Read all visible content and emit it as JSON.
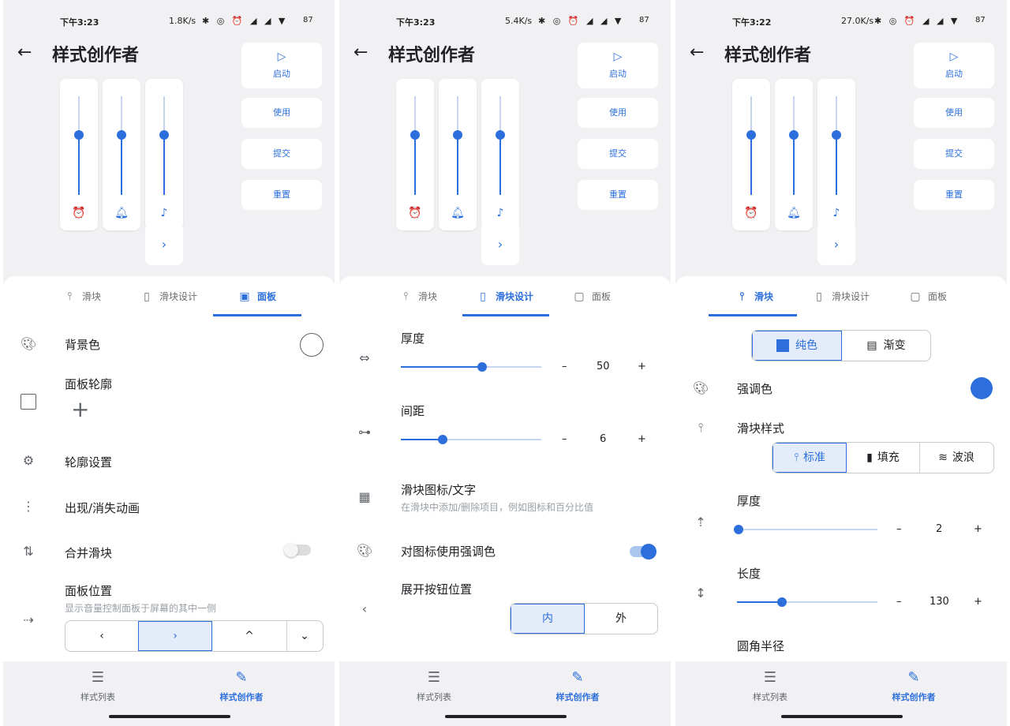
{
  "colors": {
    "accent": "#2c6fdc",
    "accent_light": "#c6d6f2",
    "bg_top": "#f1f1f3"
  },
  "screens": [
    {
      "status": {
        "time": "下午3:23",
        "speed": "1.8K/s",
        "battery": "87"
      },
      "header": {
        "title": "样式创作者",
        "back_icon": "back-arrow-icon"
      },
      "sliders": [
        "alarm-icon",
        "bell-icon",
        "music-note-icon"
      ],
      "controls": {
        "start": "启动",
        "use": "使用",
        "submit": "提交",
        "reset": "重置"
      },
      "expand_label": "›",
      "tabs": [
        {
          "label": "滑块",
          "icon": "slider-icon",
          "active": false
        },
        {
          "label": "滑块设计",
          "icon": "slider-design-icon",
          "active": false
        },
        {
          "label": "面板",
          "icon": "panel-icon",
          "active": true
        }
      ],
      "settings": {
        "background_color": "背景色",
        "panel_outline": "面板轮廓",
        "outline_settings": "轮廓设置",
        "show_hide_animation": "出现/消失动画",
        "merge_sliders": "合并滑块",
        "merge_sliders_enabled": false,
        "panel_position": "面板位置",
        "panel_position_desc": "显示音量控制面板于屏幕的其中一侧",
        "position_options": [
          "‹",
          "›",
          "^",
          "⌄"
        ],
        "position_selected": 1
      },
      "nav": [
        {
          "label": "样式列表",
          "icon": "list-icon",
          "active": false
        },
        {
          "label": "样式创作者",
          "icon": "pencil-icon",
          "active": true
        }
      ]
    },
    {
      "status": {
        "time": "下午3:23",
        "speed": "5.4K/s",
        "battery": "87"
      },
      "header": {
        "title": "样式创作者",
        "back_icon": "back-arrow-icon"
      },
      "sliders": [
        "alarm-icon",
        "bell-icon",
        "music-note-icon"
      ],
      "controls": {
        "start": "启动",
        "use": "使用",
        "submit": "提交",
        "reset": "重置"
      },
      "expand_label": "›",
      "tabs": [
        {
          "label": "滑块",
          "icon": "slider-icon",
          "active": false
        },
        {
          "label": "滑块设计",
          "icon": "slider-design-icon",
          "active": true
        },
        {
          "label": "面板",
          "icon": "panel-icon",
          "active": false
        }
      ],
      "settings": {
        "thickness": "厚度",
        "thickness_value": 50,
        "thickness_fraction": 0.58,
        "spacing": "间距",
        "spacing_value": 6,
        "spacing_fraction": 0.3,
        "slider_icon_text": "滑块图标/文字",
        "slider_icon_text_desc": "在滑块中添加/删除项目，例如图标和百分比值",
        "accent_for_icons": "对图标使用强调色",
        "accent_for_icons_enabled": true,
        "expand_button_position": "展开按钮位置",
        "expand_options": [
          "内",
          "外"
        ],
        "expand_selected": 0,
        "minus": "–",
        "plus": "+"
      },
      "nav": [
        {
          "label": "样式列表",
          "icon": "list-icon",
          "active": false
        },
        {
          "label": "样式创作者",
          "icon": "pencil-icon",
          "active": true
        }
      ]
    },
    {
      "status": {
        "time": "下午3:22",
        "speed": "27.0K/s",
        "battery": "87"
      },
      "header": {
        "title": "样式创作者",
        "back_icon": "back-arrow-icon"
      },
      "sliders": [
        "alarm-icon",
        "bell-icon",
        "music-note-icon"
      ],
      "controls": {
        "start": "启动",
        "use": "使用",
        "submit": "提交",
        "reset": "重置"
      },
      "expand_label": "›",
      "tabs": [
        {
          "label": "滑块",
          "icon": "slider-icon",
          "active": true
        },
        {
          "label": "滑块设计",
          "icon": "slider-design-icon",
          "active": false
        },
        {
          "label": "面板",
          "icon": "panel-icon",
          "active": false
        }
      ],
      "settings": {
        "fill_options": [
          "纯色",
          "渐变"
        ],
        "fill_selected": 0,
        "accent_color": "强调色",
        "slider_style": "滑块样式",
        "style_options": [
          "标准",
          "填充",
          "波浪"
        ],
        "style_selected": 0,
        "thickness": "厚度",
        "thickness_value": 2,
        "thickness_fraction": 0.0,
        "length": "长度",
        "length_value": 130,
        "length_fraction": 0.32,
        "corner_radius": "圆角半径",
        "minus": "–",
        "plus": "+"
      },
      "nav": [
        {
          "label": "样式列表",
          "icon": "list-icon",
          "active": false
        },
        {
          "label": "样式创作者",
          "icon": "pencil-icon",
          "active": true
        }
      ]
    }
  ]
}
